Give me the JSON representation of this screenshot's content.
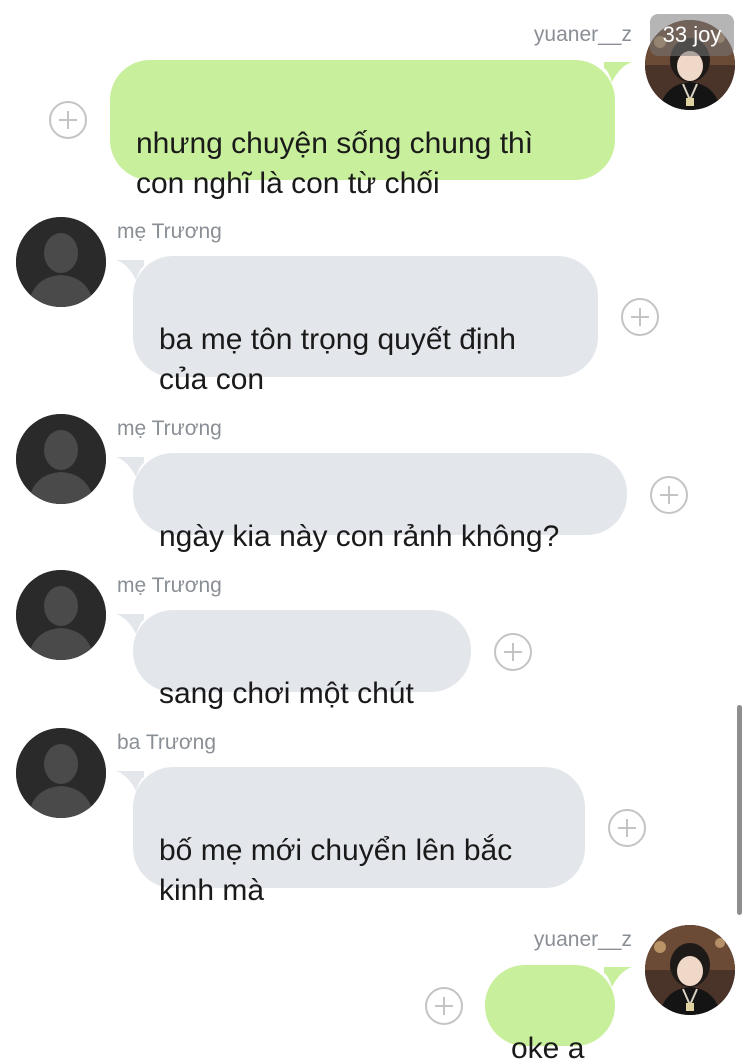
{
  "watermark": {
    "text": "33 joy"
  },
  "messages": [
    {
      "sender": "yuaner__z",
      "text": "nhưng chuyện sống chung thì\ncon nghĩ là con từ chối"
    },
    {
      "sender": "mẹ Trương",
      "text": "ba mẹ tôn trọng quyết định\ncủa con"
    },
    {
      "sender": "mẹ Trương",
      "text": "ngày kia này con rảnh không?"
    },
    {
      "sender": "mẹ Trương",
      "text": "sang chơi một chút"
    },
    {
      "sender": "ba Trương",
      "text": "bố mẹ mới chuyển lên bắc\nkinh mà"
    },
    {
      "sender": "yuaner__z",
      "text": "oke ạ"
    }
  ],
  "icons": {
    "add": "plus-circle-icon",
    "default_avatar": "person-silhouette-icon"
  },
  "colors": {
    "outgoing_bubble": "#c8ef9b",
    "incoming_bubble": "#e3e6eb",
    "sender_name": "#8a8f96",
    "plus_icon": "#c4c4c4"
  }
}
